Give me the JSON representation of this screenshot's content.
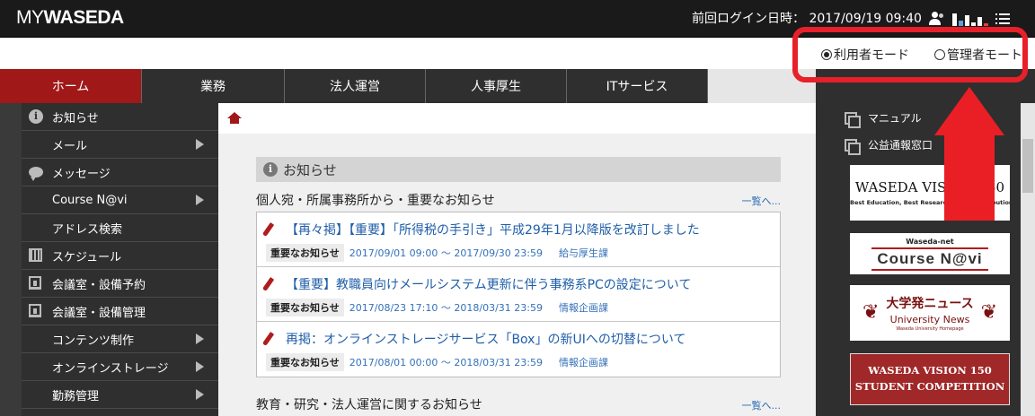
{
  "header": {
    "logo_my": "MY",
    "logo_waseda": "WASEDA",
    "login_info": "前回ログイン日時： 2017/09/19 09:40"
  },
  "mode": {
    "user_mode": "利用者モード",
    "admin_mode": "管理者モート",
    "selected": "user"
  },
  "nav": {
    "items": [
      "ホーム",
      "業務",
      "法人運営",
      "人事厚生",
      "ITサービス"
    ],
    "active_index": 0
  },
  "sidebar": {
    "items": [
      {
        "label": "お知らせ",
        "icon": "info-icon",
        "has_submenu": false
      },
      {
        "label": "メール",
        "icon": "",
        "has_submenu": true
      },
      {
        "label": "メッセージ",
        "icon": "speech-bubble-icon",
        "has_submenu": false
      },
      {
        "label": "Course N@vi",
        "icon": "",
        "has_submenu": true
      },
      {
        "label": "アドレス検索",
        "icon": "",
        "has_submenu": false
      },
      {
        "label": "スケジュール",
        "icon": "calendar-icon",
        "has_submenu": false
      },
      {
        "label": "会議室・設備予約",
        "icon": "building-icon",
        "has_submenu": false
      },
      {
        "label": "会議室・設備管理",
        "icon": "building-icon",
        "has_submenu": false
      },
      {
        "label": "コンテンツ制作",
        "icon": "",
        "has_submenu": true
      },
      {
        "label": "オンラインストレージ",
        "icon": "",
        "has_submenu": true
      },
      {
        "label": "勤務管理",
        "icon": "",
        "has_submenu": true
      }
    ]
  },
  "main": {
    "panel_title": "お知らせ",
    "section1": {
      "heading": "個人宛・所属事務所から・重要なお知らせ",
      "more": "一覧へ...",
      "news": [
        {
          "title": "【再々掲】【重要】「所得税の手引き」平成29年1月以降版を改訂しました",
          "badge": "重要なお知らせ",
          "date": "2017/09/01 09:00 ～ 2017/09/30 23:59",
          "dept": "給与厚生課"
        },
        {
          "title": "【重要】教職員向けメールシステム更新に伴う事務系PCの設定について",
          "badge": "重要なお知らせ",
          "date": "2017/08/23 17:10 ～ 2018/03/31 23:59",
          "dept": "情報企画課"
        },
        {
          "title": "再掲：オンラインストレージサービス「Box」の新UIへの切替について",
          "badge": "重要なお知らせ",
          "date": "2017/08/01 00:00 ～ 2018/03/31 23:59",
          "dept": "情報企画課"
        }
      ]
    },
    "section2": {
      "heading": "教育・研究・法人運営に関するお知らせ",
      "more": "一覧へ..."
    }
  },
  "right": {
    "links": [
      "マニュアル",
      "公益通報窓口"
    ],
    "banners": {
      "vision_title": "WASEDA VISION 150",
      "vision_sub": "Best Education, Best Research, Best Contribution",
      "coursenavi_top": "Waseda-net",
      "coursenavi_main": "Course N@vi",
      "univnews_ja": "大学発ニュース",
      "univnews_en": "University News",
      "univnews_small": "Waseda University Homepage",
      "comp_line1": "WASEDA VISION 150",
      "comp_line2": "STUDENT COMPETITION"
    }
  },
  "annotation": {
    "color": "#ea1f26"
  }
}
